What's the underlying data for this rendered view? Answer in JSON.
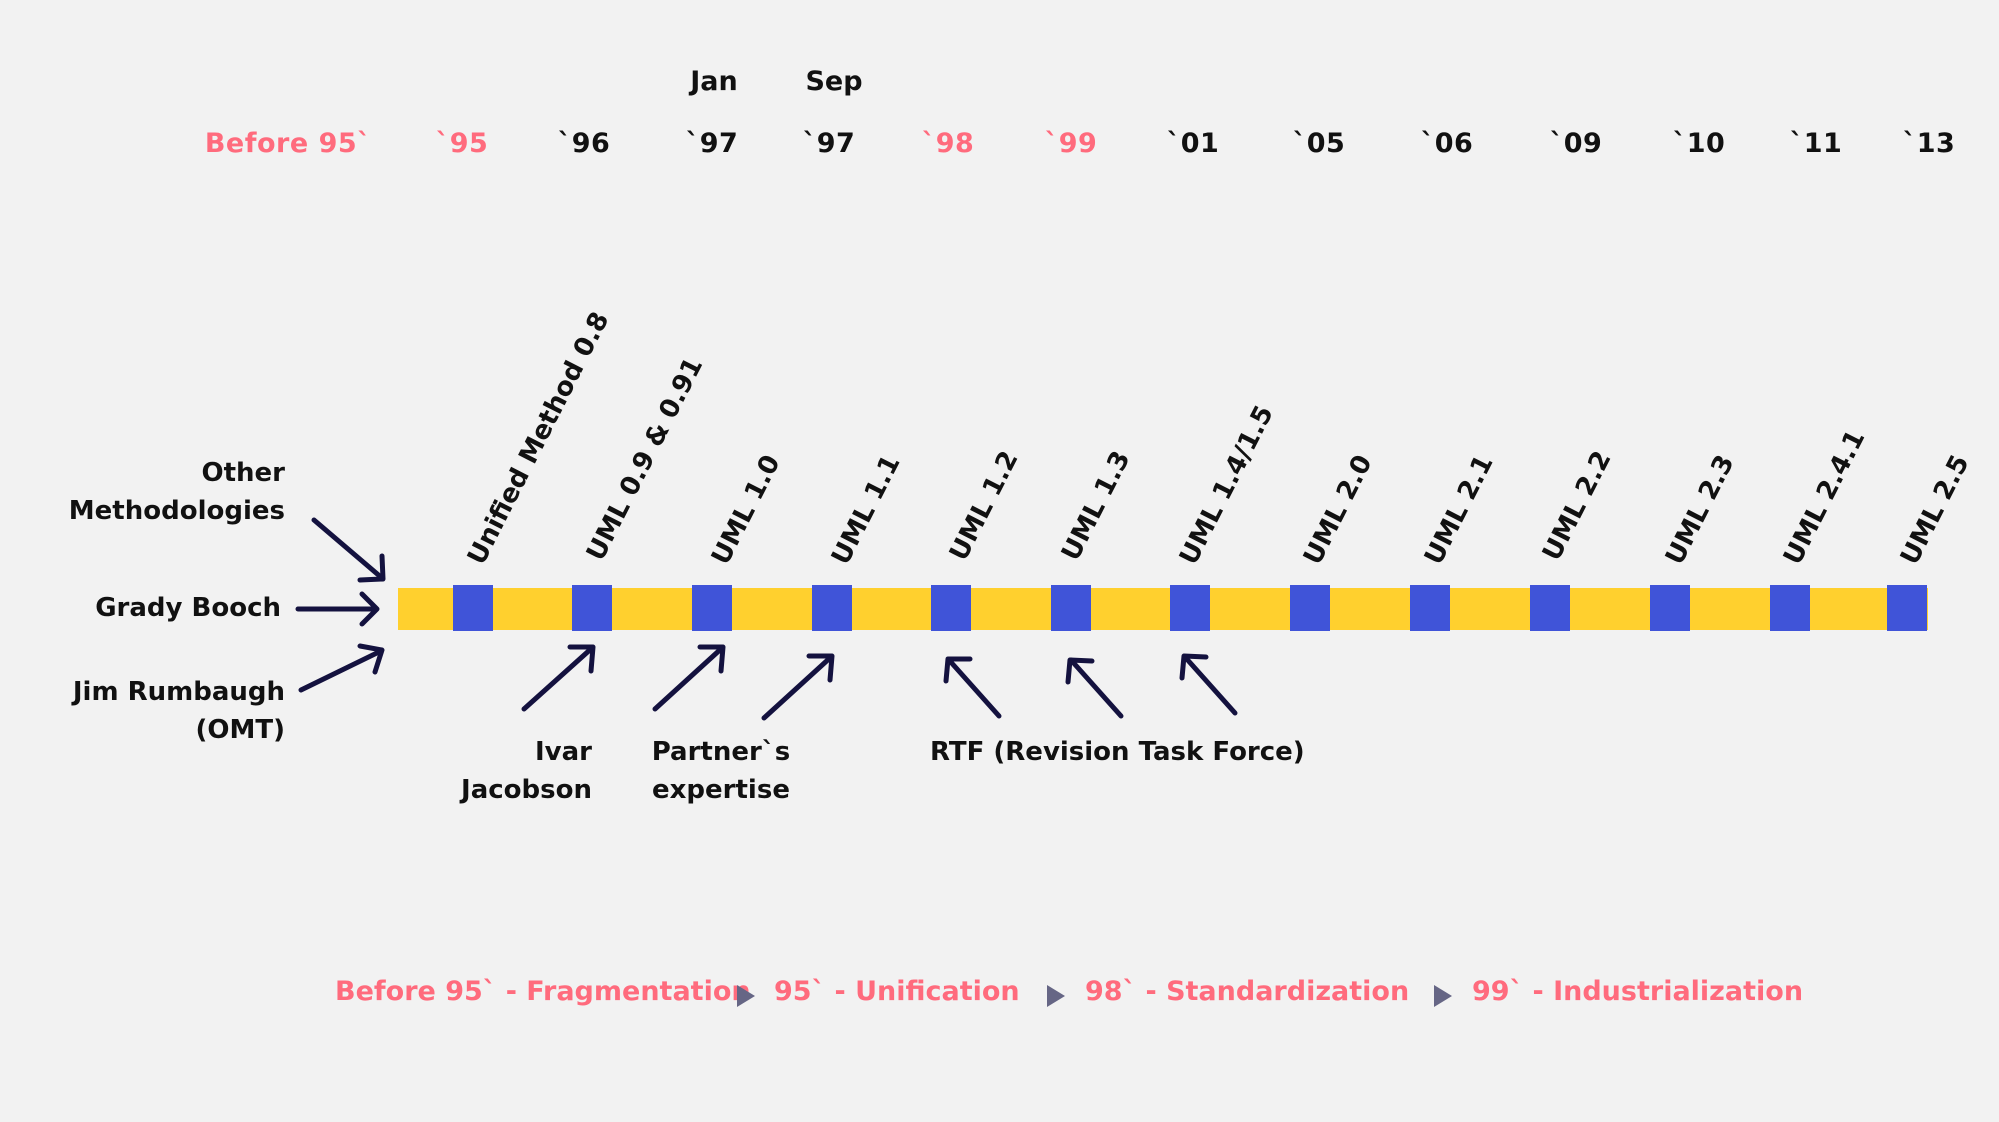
{
  "colors": {
    "accent_pink": "#ff6b7d",
    "bar_yellow": "#ffd02e",
    "marker_blue": "#4054d8",
    "arrow_navy": "#14123f",
    "legend_arrow": "#666685",
    "background": "#f2f2f2"
  },
  "years": [
    {
      "label": "Before 95`",
      "highlight": true
    },
    {
      "label": "`95",
      "highlight": true
    },
    {
      "label": "`96",
      "highlight": false
    },
    {
      "label": "`97",
      "highlight": false,
      "month": "Jan"
    },
    {
      "label": "`97",
      "highlight": false,
      "month": "Sep"
    },
    {
      "label": "`98",
      "highlight": true
    },
    {
      "label": "`99",
      "highlight": true
    },
    {
      "label": "`01",
      "highlight": false
    },
    {
      "label": "`05",
      "highlight": false
    },
    {
      "label": "`06",
      "highlight": false
    },
    {
      "label": "`09",
      "highlight": false
    },
    {
      "label": "`10",
      "highlight": false
    },
    {
      "label": "`11",
      "highlight": false
    },
    {
      "label": "`13",
      "highlight": false
    }
  ],
  "versions": [
    "Unified Method 0.8",
    "UML 0.9 & 0.91",
    "UML 1.0",
    "UML 1.1",
    "UML 1.2",
    "UML 1.3",
    "UML 1.4/1.5",
    "UML 2.0",
    "UML 2.1",
    "UML 2.2",
    "UML 2.3",
    "UML 2.4.1",
    "UML 2.5"
  ],
  "inputs": {
    "other": [
      "Other",
      "Methodologies"
    ],
    "booch": "Grady Booch",
    "rumbaugh": [
      "Jim Rumbaugh",
      "(OMT)"
    ]
  },
  "contributors": {
    "ivar": [
      "Ivar",
      "Jacobson"
    ],
    "partners": [
      "Partner`s",
      "expertise"
    ],
    "rtf": "RTF (Revision Task Force)"
  },
  "phases": [
    "Before 95` - Fragmentation",
    "95` - Unification",
    "98` - Standardization",
    "99` - Industrialization"
  ]
}
